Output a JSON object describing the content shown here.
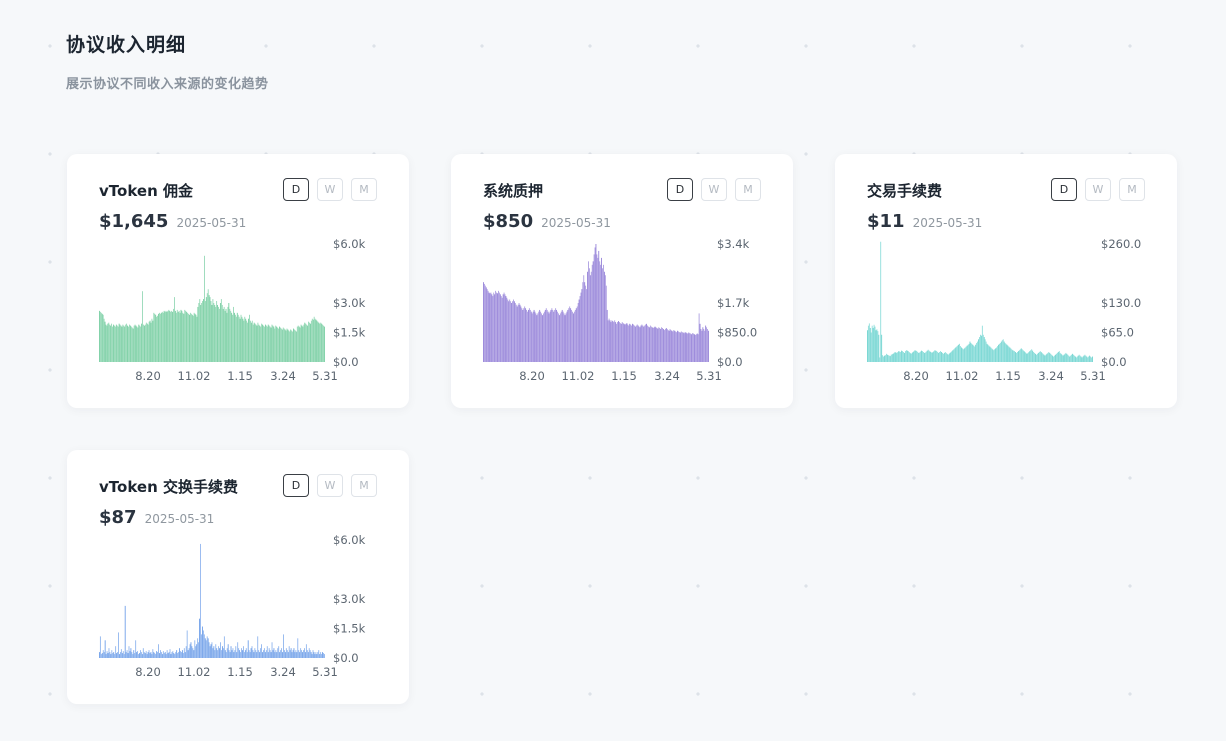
{
  "header": {
    "title": "协议收入明细",
    "subtitle": "展示协议不同收入来源的变化趋势"
  },
  "buttons": {
    "day": "D",
    "week": "W",
    "month": "M"
  },
  "cards": [
    {
      "title": "vToken 佣金",
      "value": "$1,645",
      "date": "2025-05-31",
      "color": "#6fcb9c"
    },
    {
      "title": "系统质押",
      "value": "$850",
      "date": "2025-05-31",
      "color": "#8e7ad6"
    },
    {
      "title": "交易手续费",
      "value": "$11",
      "date": "2025-05-31",
      "color": "#68d2ce"
    },
    {
      "title": "vToken 交换手续费",
      "value": "$87",
      "date": "2025-05-31",
      "color": "#6a9ce8"
    }
  ],
  "chart_data": [
    {
      "type": "bar",
      "title": "vToken 佣金",
      "x_tick_labels": [
        "8.20",
        "11.02",
        "1.15",
        "3.24",
        "5.31"
      ],
      "y_tick_labels": [
        "$6.0k",
        "$3.0k",
        "$1.5k",
        "$0.0"
      ],
      "y_tick_values": [
        6000,
        3000,
        1500,
        0
      ],
      "ylim": [
        0,
        6000
      ],
      "grid": false,
      "series": [
        {
          "values": [
            2600,
            2550,
            2500,
            2450,
            2400,
            2200,
            2050,
            1900,
            1850,
            1950,
            2000,
            1900,
            1850,
            1950,
            1800,
            1900,
            1850,
            1800,
            1900,
            1850,
            1800,
            1950,
            1900,
            1850,
            1800,
            1900,
            1850,
            1800,
            1900,
            1950,
            1850,
            1800,
            1900,
            1850,
            1800,
            1750,
            1700,
            1850,
            1900,
            1850,
            1800,
            1750,
            1900,
            1850,
            1800,
            1950,
            3600,
            1900,
            1850,
            1900,
            2000,
            1950,
            1900,
            2050,
            2100,
            2000,
            2200,
            2100,
            2500,
            2450,
            2400,
            2300,
            2350,
            2450,
            2500,
            2450,
            2500,
            2550,
            2500,
            2600,
            2550,
            2600,
            2550,
            2600,
            2650,
            2600,
            2550,
            2600,
            2550,
            2700,
            3300,
            2600,
            2500,
            2650,
            2550,
            2600,
            2500,
            2650,
            2600,
            2500,
            2450,
            2650,
            2600,
            2550,
            2500,
            2450,
            2400,
            2500,
            2450,
            2400,
            2350,
            2500,
            2450,
            2400,
            2300,
            2800,
            3000,
            3200,
            2900,
            3000,
            3100,
            3200,
            5400,
            3100,
            3300,
            3500,
            3700,
            3400,
            3300,
            3100,
            2900,
            3200,
            3000,
            2900,
            2800,
            3100,
            2900,
            2800,
            2700,
            3000,
            3200,
            2900,
            2700,
            2800,
            2600,
            2700,
            2500,
            2800,
            3000,
            2700,
            2600,
            2500,
            2400,
            2800,
            2500,
            2400,
            2300,
            2500,
            2400,
            2300,
            2200,
            2400,
            2300,
            2200,
            2100,
            2300,
            2200,
            2100,
            2000,
            2200,
            2400,
            2100,
            2000,
            2100,
            1900,
            2000,
            1950,
            1900,
            1850,
            2000,
            1900,
            1850,
            1800,
            1950,
            1900,
            1850,
            1800,
            1900,
            1850,
            1800,
            1900,
            1850,
            1800,
            1750,
            1900,
            1850,
            1800,
            1700,
            1850,
            1800,
            1750,
            1700,
            1800,
            1750,
            1700,
            1650,
            1750,
            1700,
            1650,
            1600,
            1700,
            1650,
            1600,
            1550,
            1650,
            1600,
            1550,
            1700,
            1650,
            1600,
            1550,
            1800,
            1850,
            1800,
            1750,
            1900,
            1850,
            1800,
            1900,
            2000,
            1950,
            1900,
            1850,
            2050,
            2000,
            1950,
            2100,
            2200,
            2150,
            2300,
            2200,
            2150,
            2100,
            2050,
            2000,
            1950,
            2000,
            1950,
            1900,
            1850,
            1800
          ]
        }
      ]
    },
    {
      "type": "bar",
      "title": "系统质押",
      "x_tick_labels": [
        "8.20",
        "11.02",
        "1.15",
        "3.24",
        "5.31"
      ],
      "y_tick_labels": [
        "$3.4k",
        "$1.7k",
        "$850.0",
        "$0.0"
      ],
      "y_tick_values": [
        3400,
        1700,
        850,
        0
      ],
      "ylim": [
        0,
        3400
      ],
      "grid": false,
      "series": [
        {
          "values": [
            2300,
            2250,
            2200,
            2150,
            2100,
            2050,
            2000,
            1980,
            2000,
            1950,
            1900,
            2000,
            1950,
            2050,
            2000,
            1980,
            2050,
            2000,
            1950,
            1900,
            1850,
            1950,
            2000,
            1950,
            1900,
            1850,
            1800,
            1750,
            1800,
            1750,
            1700,
            1750,
            1800,
            1750,
            1700,
            1650,
            1600,
            1650,
            1700,
            1650,
            1600,
            1550,
            1500,
            1550,
            1600,
            1550,
            1500,
            1450,
            1500,
            1550,
            1500,
            1450,
            1400,
            1450,
            1500,
            1450,
            1400,
            1350,
            1400,
            1450,
            1500,
            1450,
            1400,
            1350,
            1400,
            1450,
            1500,
            1550,
            1500,
            1450,
            1400,
            1450,
            1500,
            1550,
            1500,
            1450,
            1500,
            1550,
            1500,
            1450,
            1400,
            1350,
            1400,
            1450,
            1500,
            1450,
            1400,
            1350,
            1400,
            1450,
            1500,
            1550,
            1600,
            1550,
            1500,
            1450,
            1400,
            1450,
            1500,
            1550,
            1600,
            1700,
            1800,
            1900,
            2000,
            2100,
            2300,
            2500,
            2300,
            2200,
            2100,
            2600,
            2900,
            2700,
            2500,
            2600,
            2800,
            2900,
            3100,
            3300,
            3400,
            3100,
            3000,
            3200,
            2900,
            2800,
            3000,
            2700,
            2800,
            2600,
            2500,
            2200,
            1500,
            1200,
            1250,
            1200,
            1150,
            1200,
            1180,
            1150,
            1200,
            1150,
            1100,
            1150,
            1180,
            1150,
            1120,
            1100,
            1150,
            1120,
            1100,
            1080,
            1100,
            1120,
            1080,
            1050,
            1100,
            1080,
            1050,
            1100,
            1080,
            1050,
            1020,
            1050,
            1080,
            1050,
            1020,
            1000,
            1050,
            1080,
            1050,
            1020,
            1050,
            1080,
            1100,
            1050,
            1020,
            1000,
            1050,
            1020,
            1000,
            980,
            1000,
            1020,
            1000,
            980,
            960,
            1000,
            980,
            950,
            1000,
            980,
            950,
            920,
            950,
            980,
            950,
            920,
            900,
            950,
            920,
            900,
            880,
            920,
            900,
            880,
            860,
            900,
            880,
            860,
            850,
            880,
            860,
            850,
            830,
            860,
            850,
            830,
            820,
            850,
            830,
            820,
            800,
            830,
            820,
            800,
            780,
            800,
            820,
            800,
            1400,
            1100,
            950,
            900,
            1000,
            950,
            900,
            1050,
            1000,
            950,
            900
          ]
        }
      ]
    },
    {
      "type": "bar",
      "title": "交易手续费",
      "x_tick_labels": [
        "8.20",
        "11.02",
        "1.15",
        "3.24",
        "5.31"
      ],
      "y_tick_labels": [
        "$260.0",
        "$130.0",
        "$65.0",
        "$0.0"
      ],
      "y_tick_values": [
        260,
        130,
        65,
        0
      ],
      "ylim": [
        0,
        260
      ],
      "grid": false,
      "series": [
        {
          "values": [
            70,
            80,
            85,
            75,
            65,
            80,
            75,
            82,
            78,
            70,
            72,
            68,
            60,
            10,
            265,
            60,
            15,
            12,
            14,
            15,
            18,
            16,
            15,
            14,
            13,
            16,
            17,
            18,
            20,
            22,
            21,
            20,
            22,
            24,
            23,
            22,
            25,
            24,
            22,
            20,
            24,
            26,
            25,
            24,
            22,
            20,
            18,
            20,
            22,
            24,
            26,
            25,
            24,
            22,
            20,
            21,
            23,
            25,
            24,
            22,
            20,
            21,
            23,
            25,
            27,
            25,
            23,
            22,
            20,
            22,
            24,
            26,
            25,
            24,
            22,
            20,
            22,
            24,
            22,
            20,
            18,
            20,
            22,
            20,
            18,
            16,
            18,
            20,
            22,
            24,
            26,
            28,
            30,
            32,
            34,
            36,
            38,
            40,
            35,
            32,
            30,
            28,
            30,
            32,
            34,
            36,
            38,
            40,
            45,
            42,
            40,
            38,
            36,
            34,
            38,
            42,
            45,
            50,
            55,
            60,
            58,
            80,
            60,
            55,
            50,
            45,
            40,
            38,
            36,
            34,
            32,
            30,
            28,
            26,
            28,
            30,
            32,
            35,
            38,
            40,
            42,
            45,
            48,
            50,
            45,
            42,
            40,
            38,
            36,
            34,
            32,
            30,
            28,
            26,
            25,
            24,
            22,
            20,
            22,
            24,
            26,
            28,
            30,
            28,
            26,
            24,
            22,
            20,
            18,
            20,
            22,
            24,
            26,
            28,
            25,
            22,
            20,
            18,
            16,
            18,
            20,
            22,
            24,
            22,
            20,
            18,
            16,
            14,
            16,
            18,
            20,
            22,
            20,
            18,
            16,
            14,
            12,
            14,
            16,
            18,
            20,
            22,
            24,
            20,
            18,
            16,
            14,
            16,
            18,
            20,
            18,
            16,
            14,
            12,
            14,
            16,
            18,
            16,
            14,
            12,
            10,
            12,
            14,
            16,
            14,
            12,
            10,
            12,
            14,
            16,
            14,
            12,
            10,
            12,
            14,
            12,
            10,
            12
          ]
        }
      ]
    },
    {
      "type": "bar",
      "title": "vToken 交换手续费",
      "x_tick_labels": [
        "8.20",
        "11.02",
        "1.15",
        "3.24",
        "5.31"
      ],
      "y_tick_labels": [
        "$6.0k",
        "$3.0k",
        "$1.5k",
        "$0.0"
      ],
      "y_tick_values": [
        6000,
        3000,
        1500,
        0
      ],
      "ylim": [
        0,
        6000
      ],
      "grid": false,
      "series": [
        {
          "values": [
            300,
            1100,
            200,
            250,
            400,
            300,
            900,
            200,
            350,
            250,
            500,
            300,
            200,
            400,
            250,
            300,
            200,
            600,
            250,
            300,
            1300,
            200,
            300,
            450,
            250,
            350,
            200,
            2650,
            300,
            400,
            250,
            600,
            350,
            500,
            300,
            200,
            400,
            250,
            900,
            300,
            350,
            200,
            250,
            400,
            300,
            200,
            500,
            300,
            250,
            350,
            200,
            300,
            400,
            250,
            300,
            200,
            450,
            300,
            250,
            200,
            350,
            300,
            700,
            250,
            400,
            300,
            200,
            350,
            250,
            300,
            200,
            400,
            250,
            300,
            450,
            200,
            300,
            350,
            250,
            200,
            300,
            400,
            250,
            300,
            500,
            350,
            300,
            400,
            250,
            500,
            300,
            600,
            1400,
            400,
            500,
            700,
            800,
            600,
            500,
            400,
            900,
            600,
            700,
            1000,
            800,
            2000,
            5800,
            1200,
            1600,
            1400,
            1200,
            1000,
            900,
            1100,
            1000,
            800,
            600,
            700,
            800,
            500,
            600,
            400,
            700,
            500,
            400,
            600,
            500,
            800,
            400,
            600,
            500,
            1100,
            400,
            300,
            500,
            700,
            400,
            300,
            600,
            400,
            500,
            300,
            400,
            600,
            300,
            800,
            500,
            400,
            300,
            500,
            400,
            600,
            300,
            400,
            500,
            300,
            900,
            400,
            300,
            500,
            600,
            400,
            300,
            500,
            400,
            300,
            1100,
            400,
            300,
            500,
            700,
            300,
            400,
            500,
            300,
            400,
            600,
            300,
            500,
            400,
            300,
            800,
            400,
            500,
            300,
            400,
            300,
            500,
            600,
            300,
            400,
            500,
            300,
            1200,
            400,
            300,
            500,
            400,
            300,
            600,
            400,
            500,
            300,
            400,
            500,
            300,
            400,
            300,
            1000,
            400,
            300,
            500,
            400,
            300,
            400,
            500,
            300,
            700,
            400,
            300,
            500,
            400,
            300,
            200,
            400,
            300,
            200,
            300,
            200,
            300,
            400,
            200,
            300,
            200,
            300,
            250,
            200
          ]
        }
      ]
    }
  ]
}
